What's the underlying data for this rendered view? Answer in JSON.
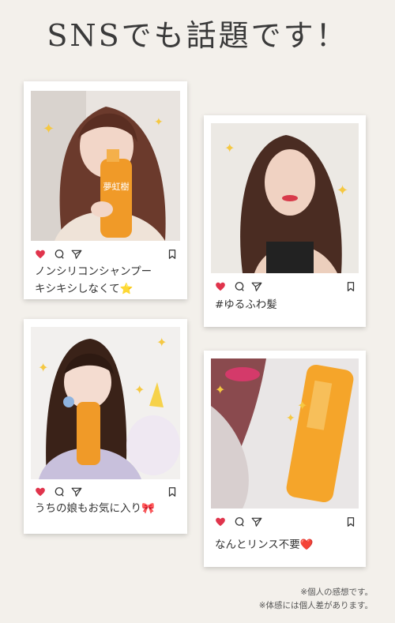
{
  "title": "SNSでも話題です！",
  "posts": [
    {
      "caption_lines": [
        "ノンシリコンシャンプー",
        "キシキシしなくて⭐"
      ]
    },
    {
      "caption_lines": [
        "#ゆるふわ髪"
      ]
    },
    {
      "caption_lines": [
        "うちの娘もお気に入り🎀"
      ]
    },
    {
      "caption_lines": [
        "なんとリンス不要❤️"
      ]
    }
  ],
  "bottle_label": "夢虹樹",
  "notes": [
    "※個人の感想です。",
    "※体感には個人差があります。"
  ],
  "colors": {
    "heart": "#e0344c",
    "bottle": "#f09a28",
    "sparkle": "#f5c842",
    "background": "#f3f0eb"
  }
}
